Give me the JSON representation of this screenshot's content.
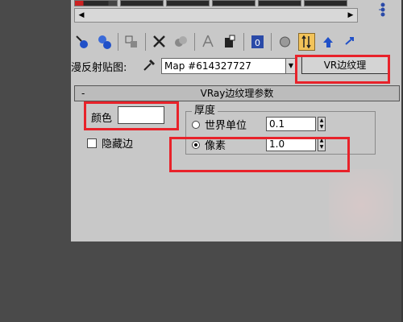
{
  "toolbar": {
    "icons": [
      "pick-material-icon",
      "put-to-scene-icon",
      "assign-material-icon",
      "reset-icon",
      "delete-icon",
      "make-unique-icon",
      "material-id-icon",
      "show-map-icon",
      "show-end-result-icon",
      "go-to-parent-icon",
      "go-forward-icon"
    ]
  },
  "map_row": {
    "label": "漫反射贴图:",
    "map_value": "Map #614327727",
    "map_type_button": "VR边纹理"
  },
  "rollout": {
    "collapse_symbol": "-",
    "title": "VRay边纹理参数"
  },
  "params": {
    "color_label": "颜色",
    "color_value": "#ffffff",
    "hidden_edges_label": "隐藏边",
    "hidden_edges_checked": false,
    "thickness_group_label": "厚度",
    "world_units_label": "世界单位",
    "world_units_value": "0.1",
    "pixels_label": "像素",
    "pixels_value": "1.0",
    "selected_mode": "pixels"
  },
  "colors": {
    "highlight": "#e8222a",
    "panel_bg": "#c8c8c8",
    "active_tool": "#f2c35a"
  }
}
